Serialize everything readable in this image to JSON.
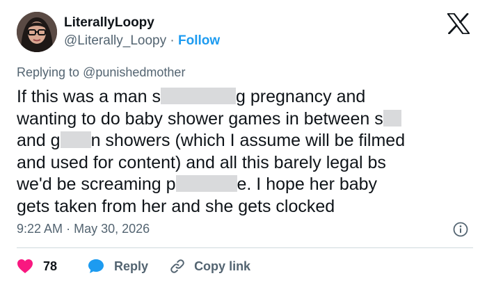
{
  "author": {
    "display_name": "LiterallyLoopy",
    "handle": "@Literally_Loopy",
    "separator": "·",
    "follow_label": "Follow"
  },
  "reply_context": {
    "prefix": "Replying to",
    "mention": "@punishedmother"
  },
  "tweet": {
    "lines": [
      [
        "If this was a man s",
        "g pregnancy and"
      ],
      [
        "wanting to do baby shower games in between s",
        ""
      ],
      [
        "and g",
        "n showers (which I assume will be filmed"
      ],
      [
        "and used for content) and all this barely legal bs"
      ],
      [
        "we'd be screaming p",
        "e. I hope her  baby"
      ],
      [
        "gets taken from her and she gets clocked"
      ]
    ]
  },
  "meta": {
    "time": "9:22 AM",
    "separator": "·",
    "date": "May 30, 2026"
  },
  "actions": {
    "like_count": "78",
    "reply_label": "Reply",
    "copy_link_label": "Copy link"
  },
  "icons": {
    "logo": "x-logo-icon",
    "info": "info-icon",
    "like": "heart-icon",
    "reply": "speech-bubble-icon",
    "copy_link": "link-icon"
  },
  "colors": {
    "accent": "#1d9bf0",
    "like": "#f91880",
    "muted": "#536471",
    "text": "#0f1419",
    "divider": "#cfd9de",
    "redaction": "#d9dadc"
  }
}
